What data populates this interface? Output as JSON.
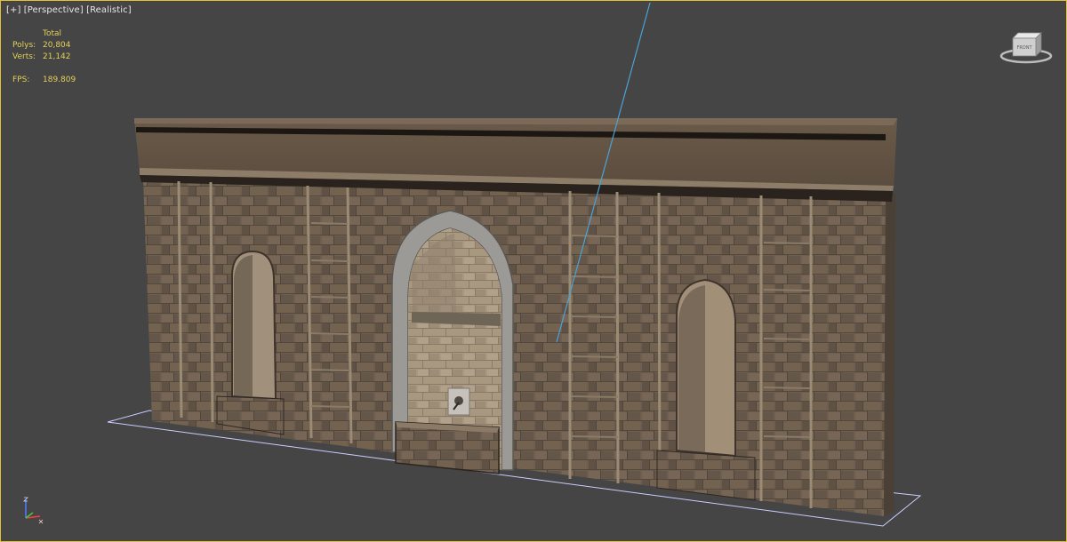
{
  "viewport": {
    "label": {
      "plus": "[+]",
      "view": "[Perspective]",
      "shading": "[Realistic]"
    },
    "stats": {
      "header": "Total",
      "polys_label": "Polys:",
      "polys_value": "20,804",
      "verts_label": "Verts:",
      "verts_value": "21,142",
      "fps_label": "FPS:",
      "fps_value": "189.809"
    },
    "viewcube": {
      "face_label": "FRONT",
      "icon": "viewcube-icon"
    },
    "axis_icon": "xyz-axis-tripod-icon"
  },
  "colors": {
    "viewport_bg": "#454545",
    "active_border": "#e3c23a",
    "stats_text": "#e2cf5a",
    "label_text": "#e6e6e6",
    "ground_outline": "#c9ccff",
    "guide_line": "#4aa3d6",
    "stone": "#6e5f50"
  }
}
